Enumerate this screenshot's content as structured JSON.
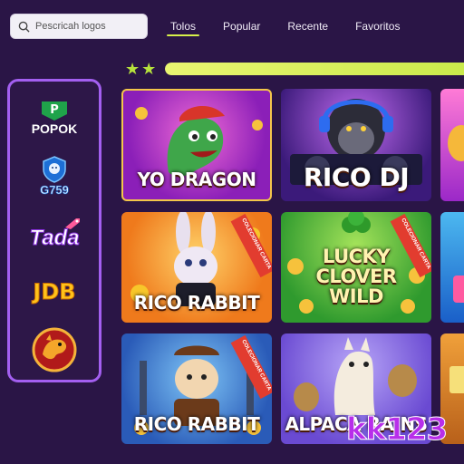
{
  "search": {
    "placeholder": "Pescricah logos"
  },
  "tabs": [
    {
      "label": "Tolos",
      "active": true
    },
    {
      "label": "Popular",
      "active": false
    },
    {
      "label": "Recente",
      "active": false
    },
    {
      "label": "Favoritos",
      "active": false
    }
  ],
  "progress": {
    "stars": 2,
    "fill_fraction": 1.0
  },
  "providers": [
    {
      "name": "POPOK",
      "icon": "popok-logo"
    },
    {
      "name": "G759",
      "icon": "lion-shield-logo"
    },
    {
      "name": "Tada",
      "icon": "tada-logo"
    },
    {
      "name": "JDB",
      "icon": "jdb-logo"
    },
    {
      "name": "",
      "icon": "dragon-logo"
    }
  ],
  "games": [
    {
      "title": "YO DRAGON",
      "ribbon": ""
    },
    {
      "title": "RICO DJ",
      "ribbon": ""
    },
    {
      "title": "RICO RABBIT",
      "ribbon": "COLECIONAR CARTA"
    },
    {
      "title": "LUCKY CLOVER WILD",
      "ribbon": "COLECIONAR CARTA"
    },
    {
      "title": "RICO RABBIT",
      "ribbon": "COLECIONAR CARTA"
    },
    {
      "title": "ALPACA RAINS",
      "ribbon": ""
    }
  ],
  "watermark": "kk123",
  "colors": {
    "background": "#2a1546",
    "sidebar_border": "#a35ff0",
    "accent_green": "#c9ea4a",
    "watermark": "#b82eea"
  }
}
